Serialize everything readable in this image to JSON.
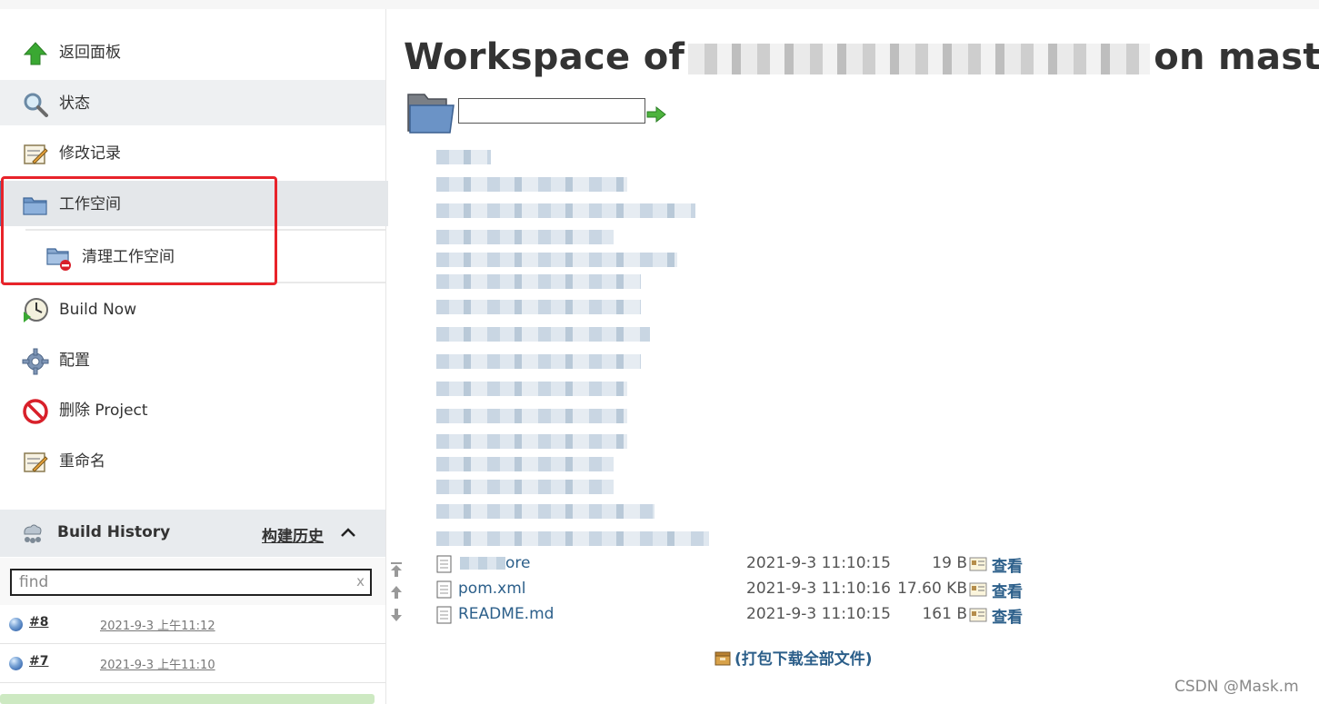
{
  "sidebar": {
    "tasks": [
      {
        "label": "返回面板",
        "icon": "up-arrow-icon"
      },
      {
        "label": "状态",
        "icon": "search-icon"
      },
      {
        "label": "修改记录",
        "icon": "notepad-icon"
      },
      {
        "label": "工作空间",
        "icon": "folder-icon"
      },
      {
        "label": "清理工作空间",
        "icon": "folder-delete-icon"
      },
      {
        "label": "Build Now",
        "icon": "clock-play-icon"
      },
      {
        "label": "配置",
        "icon": "gear-icon"
      },
      {
        "label": "删除 Project",
        "icon": "no-entry-icon"
      },
      {
        "label": "重命名",
        "icon": "notepad-icon"
      }
    ]
  },
  "build_history": {
    "title": "Build History",
    "trend_link": "构建历史",
    "search_placeholder": "find",
    "clear_label": "x",
    "builds": [
      {
        "number": "#8",
        "date": "2021-9-3 上午11:12"
      },
      {
        "number": "#7",
        "date": "2021-9-3 上午11:10"
      }
    ]
  },
  "main": {
    "title_prefix": "Workspace of",
    "title_suffix": "on master",
    "files": [
      {
        "name_visible": "ore",
        "date": "2021-9-3 11:10:15",
        "size": "19 B",
        "view": "查看"
      },
      {
        "name": "pom.xml",
        "date": "2021-9-3 11:10:16",
        "size": "17.60 KB",
        "view": "查看"
      },
      {
        "name": "README.md",
        "date": "2021-9-3 11:10:15",
        "size": "161 B",
        "view": "查看"
      }
    ],
    "download_all": "(打包下载全部文件)"
  },
  "watermark": "CSDN @Mask.m",
  "colors": {
    "link": "#2c5f8a",
    "highlight_box": "#e8232a",
    "sidebar_active": "#e4e7ea"
  }
}
